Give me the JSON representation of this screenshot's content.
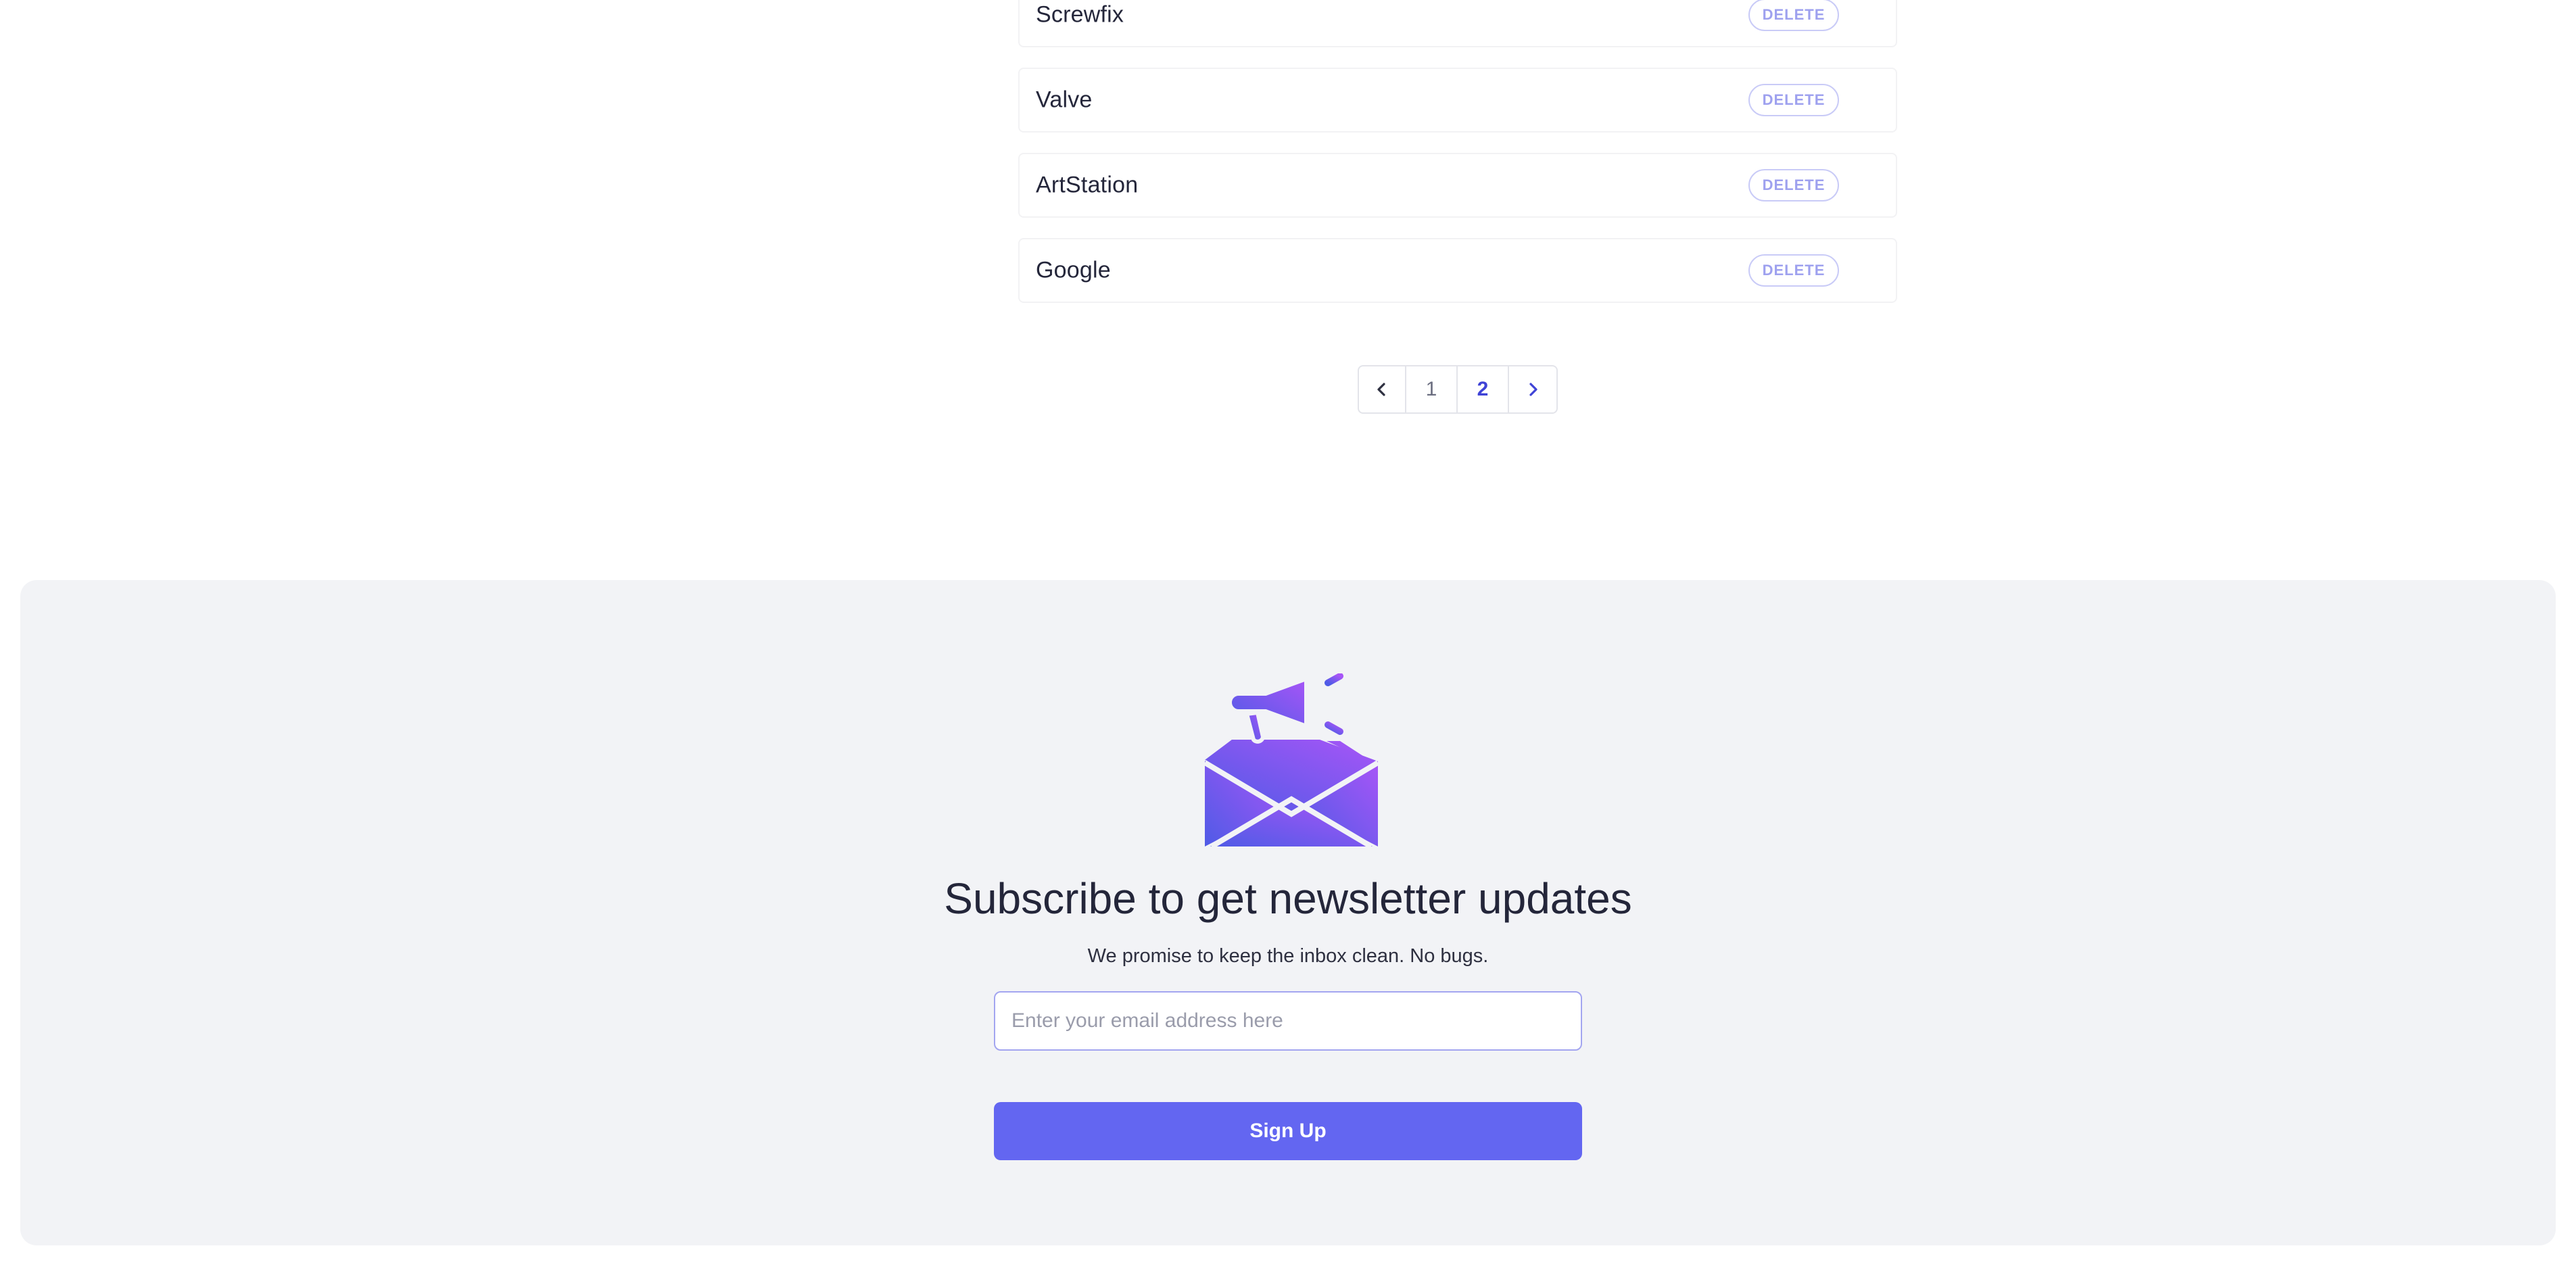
{
  "companies": {
    "items": [
      {
        "name": "Screwfix",
        "action": "DELETE"
      },
      {
        "name": "Valve",
        "action": "DELETE"
      },
      {
        "name": "ArtStation",
        "action": "DELETE"
      },
      {
        "name": "Google",
        "action": "DELETE"
      }
    ]
  },
  "pagination": {
    "prev_icon": "chevron-left-icon",
    "next_icon": "chevron-right-icon",
    "pages": [
      "1",
      "2"
    ],
    "current_page": "2"
  },
  "newsletter": {
    "icon": "megaphone-envelope-icon",
    "title": "Subscribe to get newsletter updates",
    "subtitle": "We promise to keep the inbox clean. No bugs.",
    "email_placeholder": "Enter your email address here",
    "email_value": "",
    "button_label": "Sign Up"
  },
  "colors": {
    "accent": "#6366f1",
    "accent_light": "#a855f7",
    "delete_text": "#9ea1ef",
    "panel_bg": "#f2f3f6"
  }
}
